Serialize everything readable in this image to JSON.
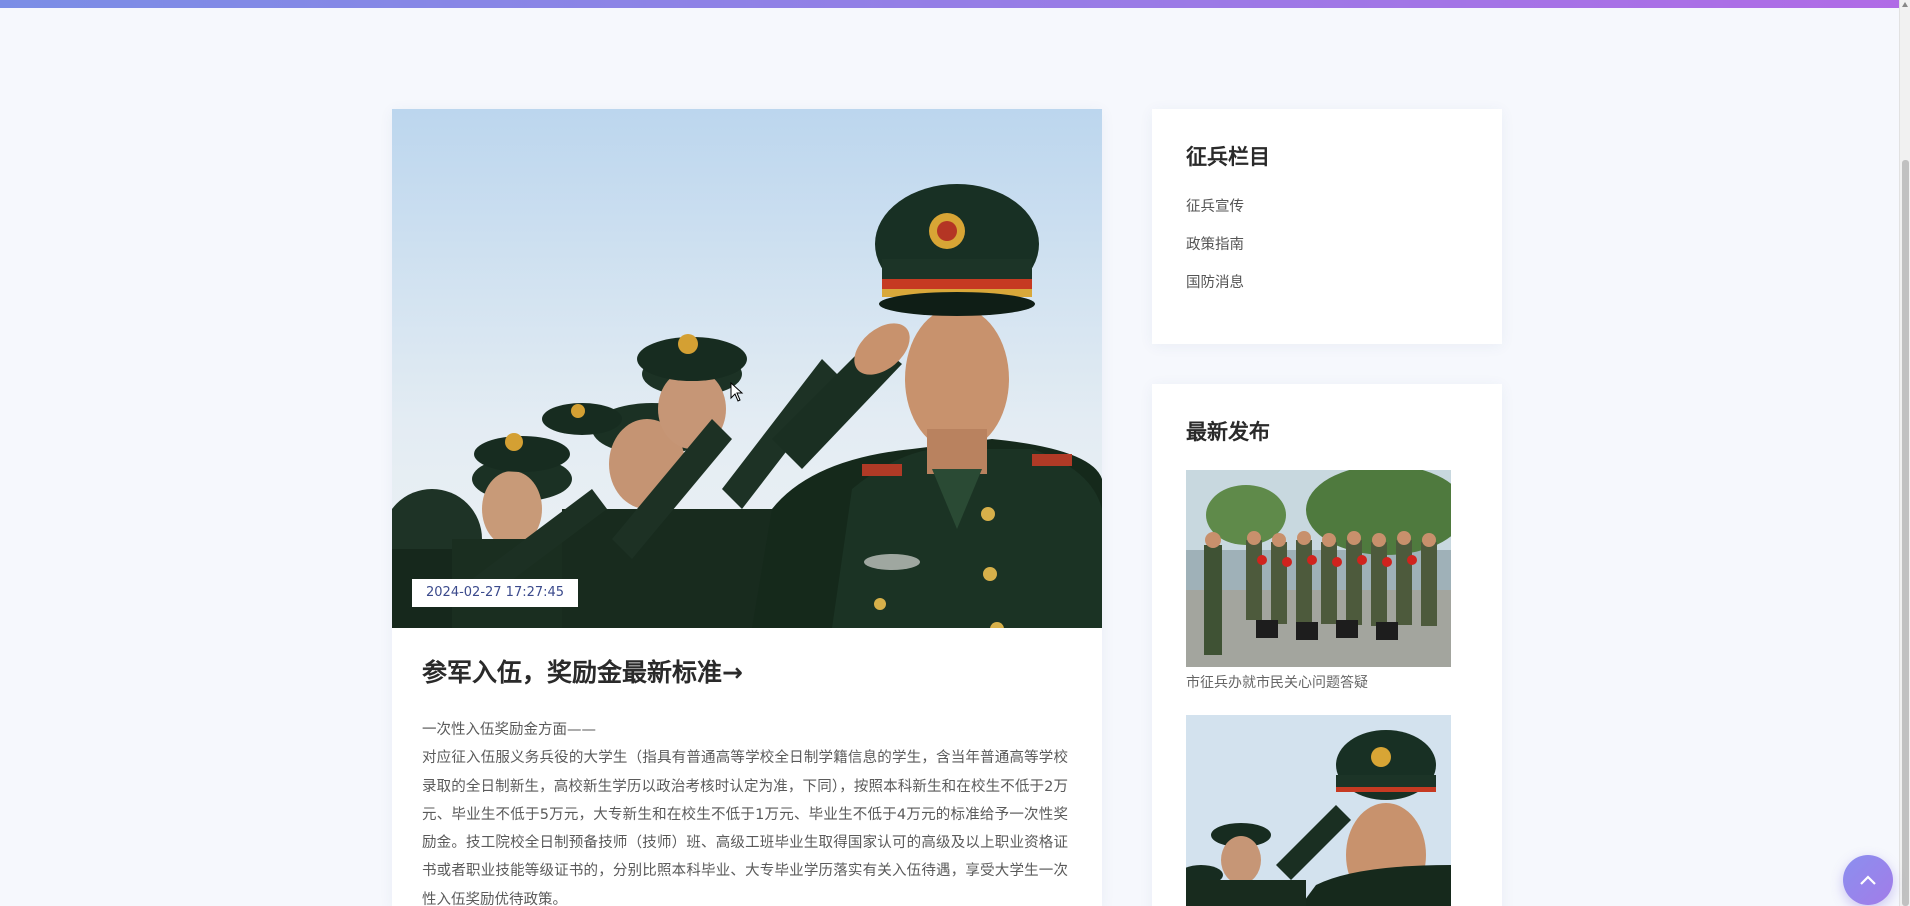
{
  "article": {
    "date": "2024-02-27 17:27:45",
    "title": "参军入伍，奖励金最新标准→",
    "para1": "一次性入伍奖励金方面——",
    "para2": "对应征入伍服义务兵役的大学生（指具有普通高等学校全日制学籍信息的学生，含当年普通高等学校录取的全日制新生，高校新生学历以政治考核时认定为准，下同），按照本科新生和在校生不低于2万元、毕业生不低于5万元，大专新生和在校生不低于1万元、毕业生不低于4万元的标准给予一次性奖励金。技工院校全日制预备技师（技师）班、高级工班毕业生取得国家认可的高级及以上职业资格证书或者职业技能等级证书的，分别比照本科毕业、大专毕业学历落实有关入伍待遇，享受大学生一次性入伍奖励优待政策。"
  },
  "categories": {
    "title": "征兵栏目",
    "items": [
      "征兵宣传",
      "政策指南",
      "国防消息"
    ]
  },
  "latest": {
    "title": "最新发布",
    "items": [
      {
        "caption": "市征兵办就市民关心问题答疑"
      },
      {
        "caption": ""
      }
    ]
  },
  "icons": {
    "fab": "chevron-up-icon"
  },
  "colors": {
    "accent_gradient_start": "#7b8ee6",
    "accent_gradient_end": "#b06be6",
    "date_text": "#3b4a8c"
  }
}
